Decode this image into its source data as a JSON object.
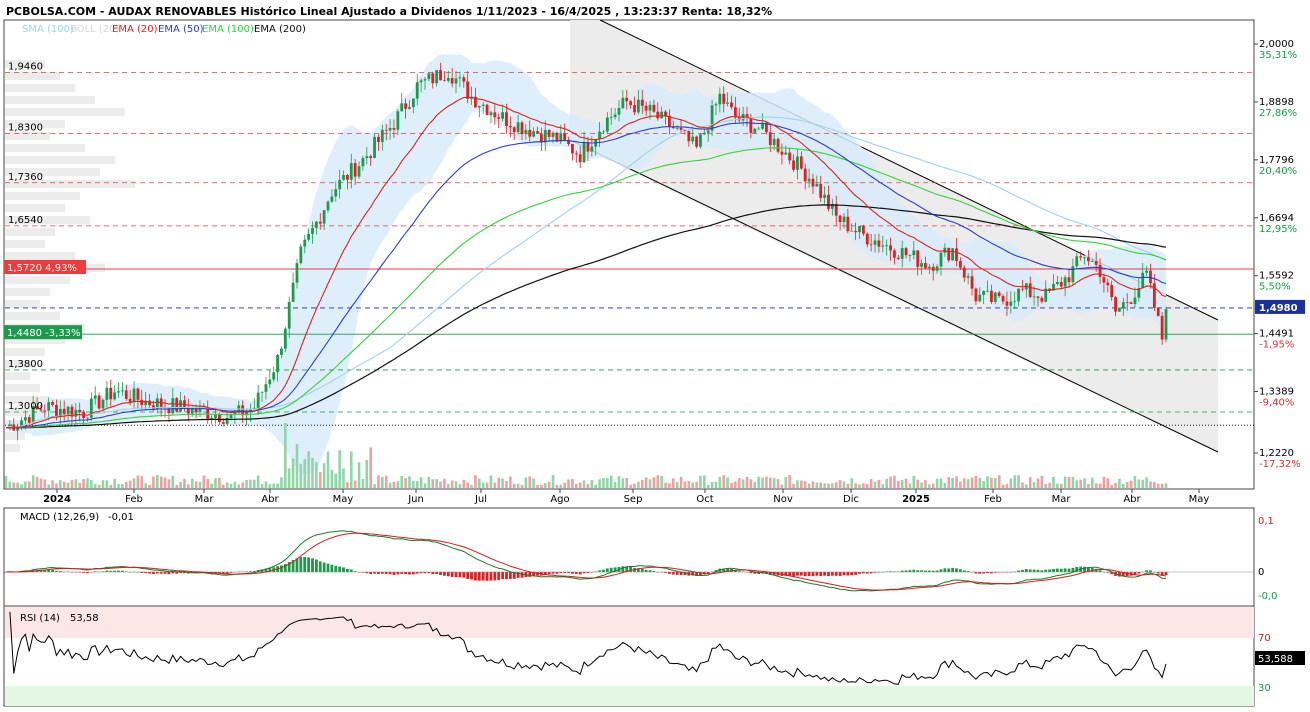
{
  "header": {
    "title": "PCBOLSA.COM - AUDAX RENOVABLES Histórico Lineal Ajustado a Dividenos 1/11/2023 - 16/4/2025 , 13:23:37 Renta: 18,32%"
  },
  "legend": [
    {
      "label": "SMA (100)",
      "color": "#9fd2f0"
    },
    {
      "label": "BOLL (20)",
      "color": "#d6d6d6"
    },
    {
      "label": "EMA (20)",
      "color": "#e0221c"
    },
    {
      "label": "EMA (50)",
      "color": "#2a3fd0"
    },
    {
      "label": "EMA (100)",
      "color": "#36d23c"
    },
    {
      "label": "EMA (200)",
      "color": "#111111"
    }
  ],
  "colors": {
    "up": "#1a9a4a",
    "down": "#e02020",
    "boll_fill": "#d8ecfa",
    "channel_fill": "#ececec",
    "red_line": "#e04040",
    "green_line": "#1a9a4a",
    "tag_red": "#ee3b3b",
    "tag_green": "#1a9a4a"
  },
  "price_axis": {
    "min": 1.2,
    "max": 2.03,
    "left_labels": [
      "1,9460",
      "1,8300",
      "1,7360",
      "1,6540",
      "1,3800",
      "1,3000"
    ],
    "right_ticks": [
      {
        "price": "2,0000",
        "pct": "35,31%"
      },
      {
        "price": "1,8898",
        "pct": "27,86%"
      },
      {
        "price": "1,7796",
        "pct": "20,40%"
      },
      {
        "price": "1,6694",
        "pct": "12,95%"
      },
      {
        "price": "1,5592",
        "pct": "5,50%"
      },
      {
        "price": "1,4491",
        "pct": "-1,95%"
      },
      {
        "price": "1,3389",
        "pct": "-9,40%"
      },
      {
        "price": "1,2220",
        "pct": "-17,32%"
      }
    ],
    "current_price": "1,4980",
    "tag_resistance": {
      "price": "1,5720",
      "pct": "4,93%"
    },
    "tag_support": {
      "price": "1,4480",
      "pct": "-3,33%"
    }
  },
  "x_axis": {
    "labels": [
      "2024",
      "Feb",
      "Mar",
      "Abr",
      "May",
      "Jun",
      "Jul",
      "Ago",
      "Sep",
      "Oct",
      "Nov",
      "Dic",
      "2025",
      "Feb",
      "Mar",
      "Abr",
      "May"
    ]
  },
  "macd": {
    "label": "MACD (12,26,9)",
    "value": "-0,01",
    "ticks": [
      "0,1",
      "0",
      "-0,0"
    ]
  },
  "rsi": {
    "label": "RSI (14)",
    "value": "53,58",
    "current": "53,588",
    "ticks": [
      "70",
      "30"
    ]
  },
  "chart_data": {
    "type": "line",
    "title": "PCBOLSA.COM - AUDAX RENOVABLES Histórico Lineal Ajustado a Dividenos 1/11/2023 - 16/4/2025 , 13:23:37 Renta: 18,32%",
    "x": [
      "2024-01",
      "2024-02",
      "2024-03",
      "2024-04",
      "2024-05",
      "2024-06",
      "2024-07",
      "2024-08",
      "2024-09",
      "2024-10",
      "2024-11",
      "2024-12",
      "2025-01",
      "2025-02",
      "2025-03",
      "2025-04"
    ],
    "series": [
      {
        "name": "",
        "values": [
          1.3,
          1.32,
          1.3,
          1.58,
          1.9,
          1.93,
          1.85,
          1.82,
          1.89,
          1.87,
          1.68,
          1.6,
          1.57,
          1.55,
          1.57,
          1.5
        ]
      },
      {
        "name": "EMA (20)",
        "values": [
          1.3,
          1.3,
          1.3,
          1.45,
          1.8,
          1.88,
          1.87,
          1.84,
          1.85,
          1.87,
          1.72,
          1.62,
          1.57,
          1.54,
          1.55,
          1.49
        ]
      },
      {
        "name": "EMA (50)",
        "values": [
          1.28,
          1.29,
          1.29,
          1.36,
          1.67,
          1.8,
          1.84,
          1.84,
          1.85,
          1.86,
          1.77,
          1.67,
          1.6,
          1.56,
          1.55,
          1.51
        ]
      },
      {
        "name": "EMA (100)",
        "values": [
          1.27,
          1.28,
          1.29,
          1.32,
          1.5,
          1.66,
          1.73,
          1.77,
          1.8,
          1.82,
          1.79,
          1.73,
          1.67,
          1.62,
          1.59,
          1.55
        ]
      },
      {
        "name": "EMA (200)",
        "values": [
          1.25,
          1.25,
          1.26,
          1.27,
          1.35,
          1.44,
          1.52,
          1.58,
          1.62,
          1.67,
          1.7,
          1.69,
          1.67,
          1.64,
          1.62,
          1.6
        ]
      }
    ],
    "ylim": [
      1.2,
      2.03
    ],
    "ylabel": "",
    "xlabel": "",
    "grid": false,
    "legend": "top-left"
  }
}
